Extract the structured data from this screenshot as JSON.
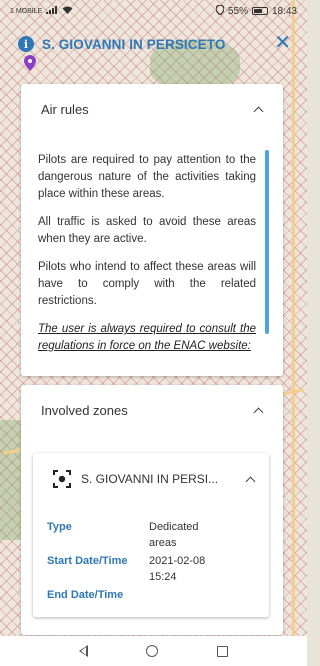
{
  "status_bar": {
    "carrier": "1 MOBILE",
    "battery": "55%",
    "time": "18:43"
  },
  "header": {
    "title": "S. GIOVANNI IN PERSICETO",
    "info_icon": "info-icon",
    "close_icon": "close-icon",
    "pin_icon": "map-pin-icon"
  },
  "air_rules": {
    "title": "Air rules",
    "paragraphs": [
      "Pilots are required to pay attention to the dangerous nature of the activities taking place within these areas.",
      "All traffic is asked to avoid these areas when they are active.",
      "Pilots who intend to affect these areas will have to comply with the related restrictions."
    ],
    "note": "The user is always required to consult the regulations in force on the ENAC website:"
  },
  "zones": {
    "title": "Involved zones",
    "zone": {
      "name": "S. GIOVANNI IN PERSI...",
      "icon": "target-icon",
      "rows": [
        {
          "label": "Type",
          "value": "Dedicated areas"
        },
        {
          "label": "Start Date/Time",
          "value": "2021-02-08 15:24"
        },
        {
          "label": "End Date/Time",
          "value": ""
        }
      ]
    }
  },
  "colors": {
    "accent": "#2e78b7",
    "scrollbar": "#4da3e6"
  }
}
